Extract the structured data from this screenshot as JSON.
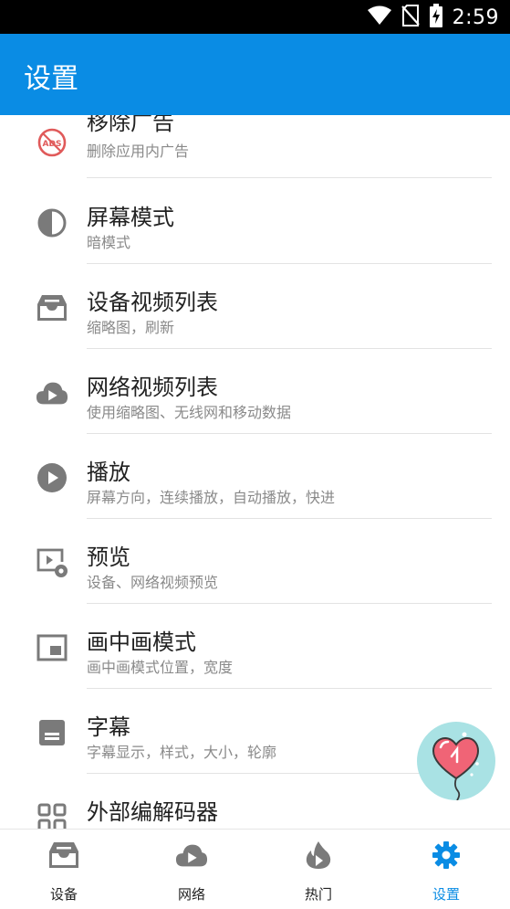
{
  "status_bar": {
    "time": "2:59",
    "icons": [
      "wifi-icon",
      "no-sim-icon",
      "battery-charging-icon"
    ]
  },
  "app_bar": {
    "title": "设置"
  },
  "settings": [
    {
      "icon": "remove-ads-icon",
      "title": "移除广告",
      "subtitle": "删除应用内广告"
    },
    {
      "icon": "contrast-icon",
      "title": "屏幕模式",
      "subtitle": "暗模式"
    },
    {
      "icon": "inbox-icon",
      "title": "设备视频列表",
      "subtitle": "缩略图，刷新"
    },
    {
      "icon": "cloud-play-icon",
      "title": "网络视频列表",
      "subtitle": "使用缩略图、无线网和移动数据"
    },
    {
      "icon": "play-circle-icon",
      "title": "播放",
      "subtitle": "屏幕方向，连续播放，自动播放，快进"
    },
    {
      "icon": "preview-icon",
      "title": "预览",
      "subtitle": "设备、网络视频预览"
    },
    {
      "icon": "picture-in-picture-icon",
      "title": "画中画模式",
      "subtitle": "画中画模式位置，宽度"
    },
    {
      "icon": "subtitles-icon",
      "title": "字幕",
      "subtitle": "字幕显示，样式，大小，轮廓"
    },
    {
      "icon": "decoder-icon",
      "title": "外部编解码器",
      "subtitle": ""
    }
  ],
  "bottom_nav": [
    {
      "icon": "inbox-icon",
      "label": "设备",
      "active": false
    },
    {
      "icon": "cloud-play-icon",
      "label": "网络",
      "active": false
    },
    {
      "icon": "fire-play-icon",
      "label": "热门",
      "active": false
    },
    {
      "icon": "gear-icon",
      "label": "设置",
      "active": true
    }
  ],
  "colors": {
    "primary": "#0a8ce4",
    "icon_gray": "#7a7a7a",
    "ads_red": "#e05a5a",
    "fab_background": "#a9e2e4",
    "balloon": "#f06476"
  }
}
